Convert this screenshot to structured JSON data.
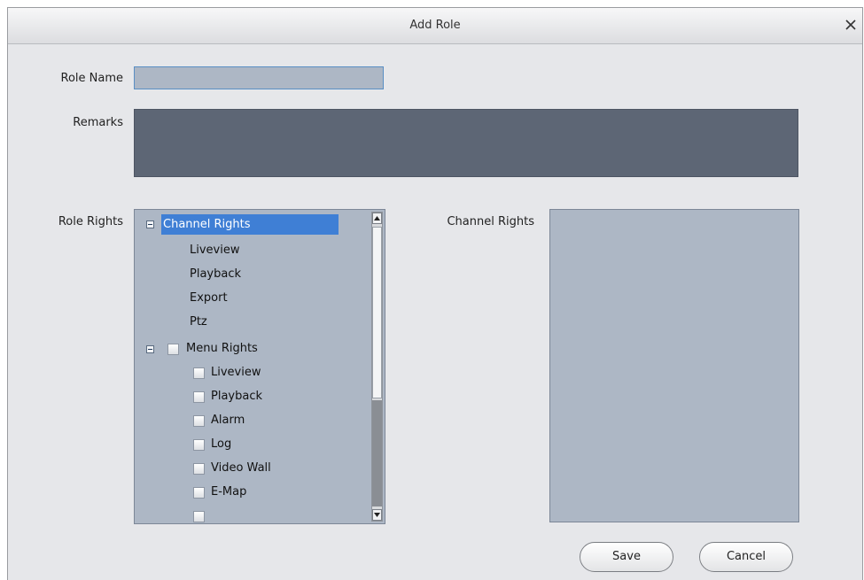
{
  "dialog": {
    "title": "Add Role",
    "close_label": "×"
  },
  "form": {
    "role_name_label": "Role Name",
    "role_name_value": "",
    "remarks_label": "Remarks",
    "remarks_value": "",
    "role_rights_label": "Role Rights",
    "channel_rights_label": "Channel Rights"
  },
  "tree": {
    "channel_rights": {
      "label": "Channel Rights",
      "children": [
        "Liveview",
        "Playback",
        "Export",
        "Ptz"
      ]
    },
    "menu_rights": {
      "label": "Menu Rights",
      "children": [
        "Liveview",
        "Playback",
        "Alarm",
        "Log",
        "Video Wall",
        "E-Map"
      ]
    }
  },
  "buttons": {
    "save": "Save",
    "cancel": "Cancel"
  },
  "colors": {
    "selection": "#3f7fd5",
    "panel": "#adb7c5",
    "remarks_bg": "#5d6675"
  }
}
